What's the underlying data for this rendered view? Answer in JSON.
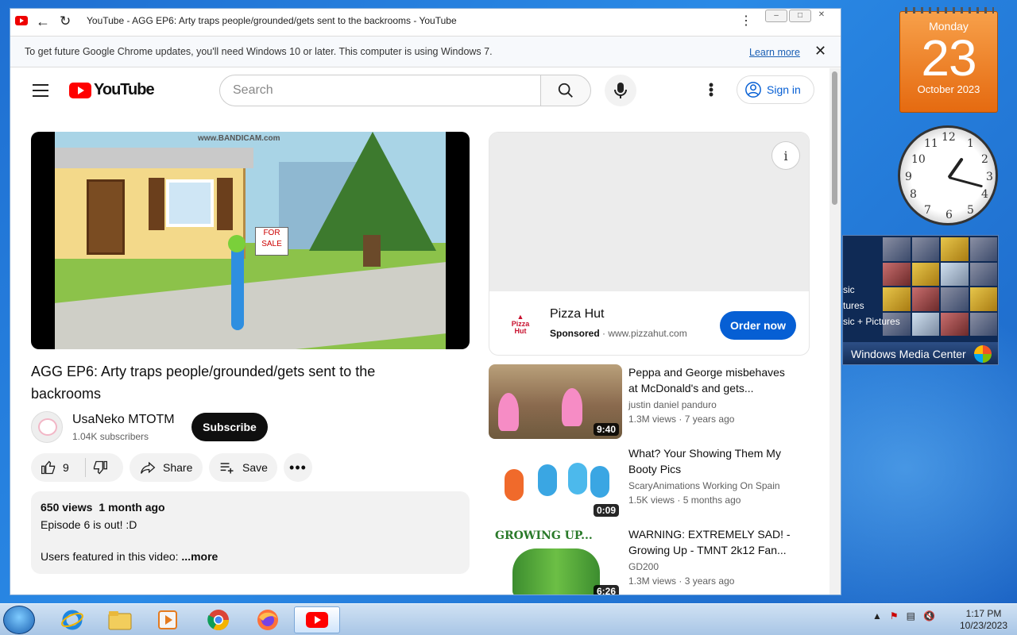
{
  "browser": {
    "tab_title": "YouTube - AGG EP6: Arty traps people/grounded/gets sent to the backrooms - YouTube",
    "infobar_message": "To get future Google Chrome updates, you'll need Windows 10 or later. This computer is using Windows 7.",
    "infobar_link": "Learn more"
  },
  "youtube": {
    "logo_text": "YouTube",
    "search_placeholder": "Search",
    "sign_in": "Sign in",
    "video": {
      "watermark": "www.BANDICAM.com",
      "sign_text": "FOR SALE",
      "title": "AGG EP6: Arty traps people/grounded/gets sent to the backrooms",
      "channel": "UsaNeko MTOTM",
      "subscribers": "1.04K subscribers",
      "subscribe_label": "Subscribe",
      "likes": "9",
      "share_label": "Share",
      "save_label": "Save",
      "views": "650 views",
      "age": "1 month ago",
      "desc_line1": "Episode 6 is out! :D",
      "desc_line2": "Users featured in this video:",
      "more_label": "...more"
    },
    "ad": {
      "brand": "Pizza Hut",
      "sponsored": "Sponsored",
      "url": "www.pizzahut.com",
      "cta": "Order now",
      "logo_text": "Pizza Hut"
    },
    "recommendations": [
      {
        "title": "Peppa and George misbehaves at McDonald's and gets...",
        "channel": "justin daniel panduro",
        "views": "1.3M views",
        "age": "7 years ago",
        "duration": "9:40"
      },
      {
        "title": "What? Your Showing Them My Booty Pics",
        "channel": "ScaryAnimations Working On Spain",
        "views": "1.5K views",
        "age": "5 months ago",
        "duration": "0:09"
      },
      {
        "title": "WARNING: EXTREMELY SAD! - Growing Up - TMNT 2k12 Fan...",
        "channel": "GD200",
        "views": "1.3M views",
        "age": "3 years ago",
        "duration": "6:26",
        "thumb_text": "GROWING UP..."
      }
    ]
  },
  "desktop": {
    "calendar": {
      "weekday": "Monday",
      "day": "23",
      "month_year": "October 2023"
    },
    "clock_numbers": [
      "12",
      "1",
      "2",
      "3",
      "4",
      "5",
      "6",
      "7",
      "8",
      "9",
      "10",
      "11"
    ],
    "media_center": {
      "label": "Windows Media Center",
      "menu": [
        "sic",
        "tures",
        "sic + Pictures"
      ]
    }
  },
  "taskbar": {
    "time": "1:17 PM",
    "date": "10/23/2023"
  },
  "colors": {
    "youtube_red": "#ff0000",
    "link_blue": "#065fd4",
    "calendar_orange": "#e56a10"
  }
}
